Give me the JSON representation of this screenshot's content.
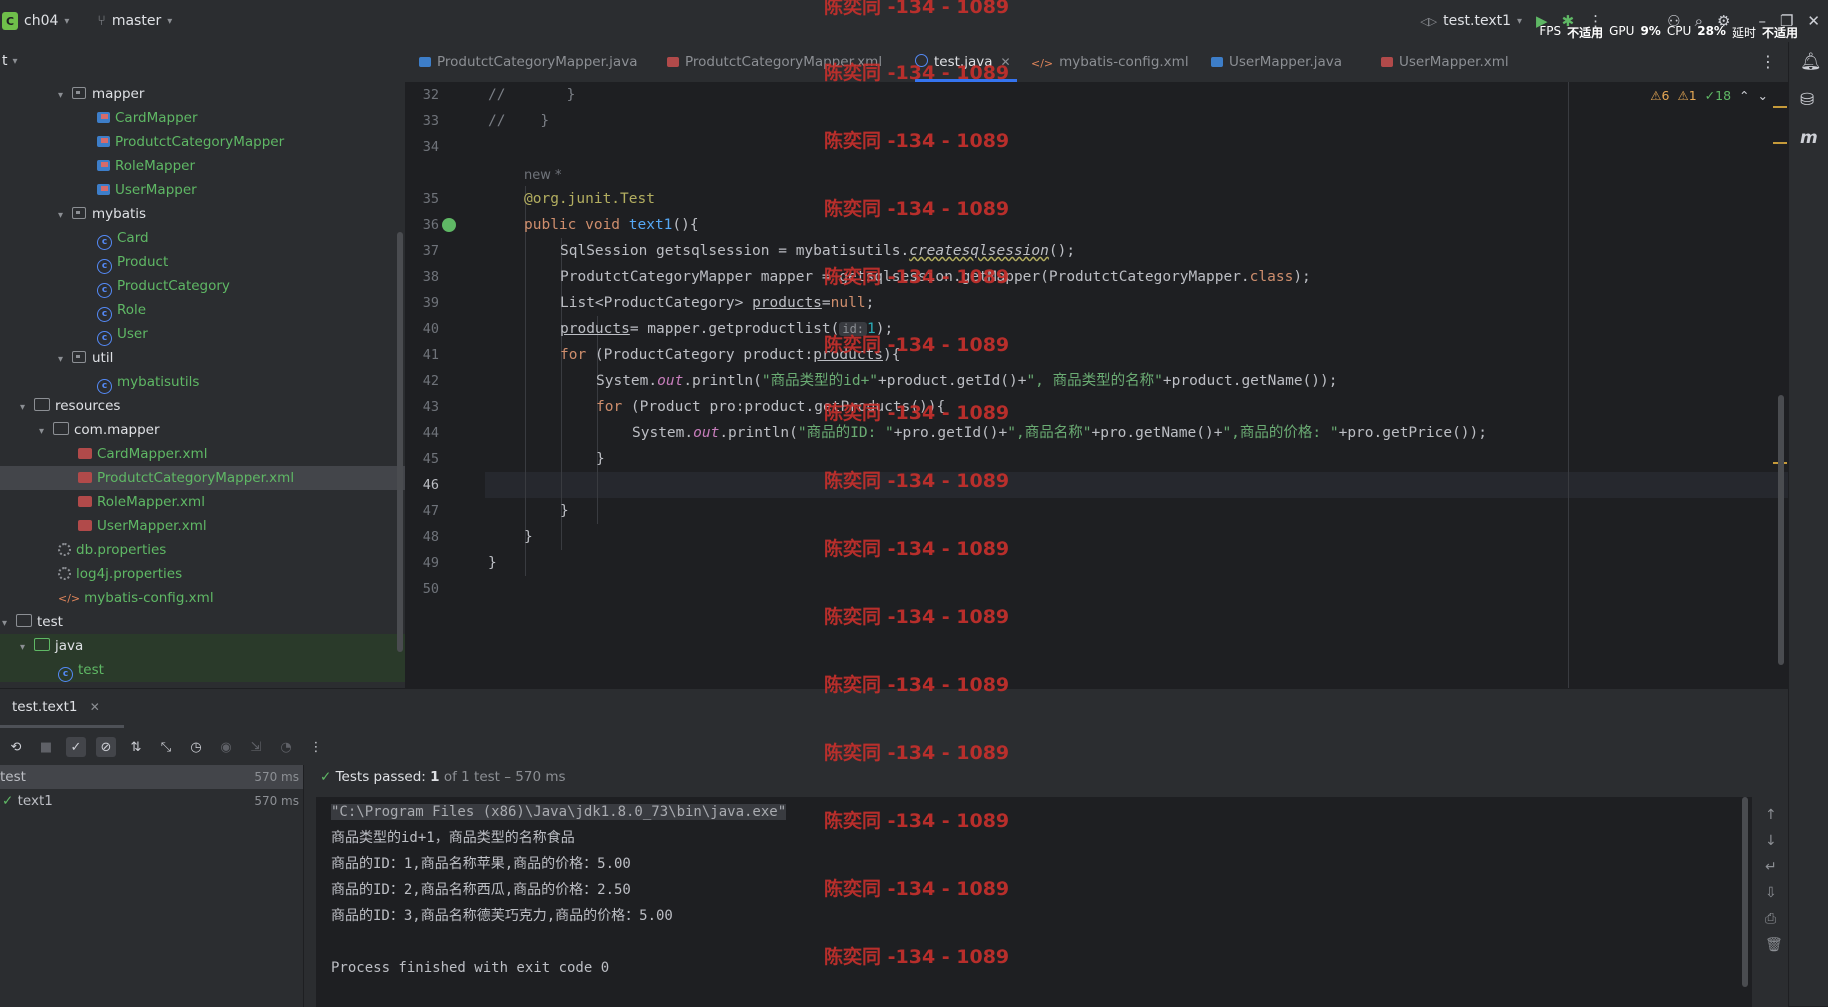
{
  "titlebar": {
    "project_badge": "C",
    "project": "ch04",
    "branch": "master",
    "run_config": "test.text1",
    "sysmon": {
      "fps_label": "FPS",
      "fps_value": "不适用",
      "gpu_label": "GPU",
      "gpu_value": "9%",
      "cpu_label": "CPU",
      "cpu_value": "28%",
      "latency_label": "延时",
      "latency_value": "不适用"
    }
  },
  "project_panel": {
    "header": "t",
    "rows": [
      {
        "label": "mapper"
      },
      {
        "label": "CardMapper"
      },
      {
        "label": "ProdutctCategoryMapper"
      },
      {
        "label": "RoleMapper"
      },
      {
        "label": "UserMapper"
      },
      {
        "label": "mybatis"
      },
      {
        "label": "Card"
      },
      {
        "label": "Product"
      },
      {
        "label": "ProductCategory"
      },
      {
        "label": "Role"
      },
      {
        "label": "User"
      },
      {
        "label": "util"
      },
      {
        "label": "mybatisutils"
      },
      {
        "label": "resources"
      },
      {
        "label": "com.mapper"
      },
      {
        "label": "CardMapper.xml"
      },
      {
        "label": "ProdutctCategoryMapper.xml"
      },
      {
        "label": "RoleMapper.xml"
      },
      {
        "label": "UserMapper.xml"
      },
      {
        "label": "db.properties"
      },
      {
        "label": "log4j.properties"
      },
      {
        "label": "mybatis-config.xml"
      },
      {
        "label": "test"
      },
      {
        "label": "java"
      },
      {
        "label": "test"
      }
    ]
  },
  "editor_tabs": [
    {
      "label": "ProdutctCategoryMapper.java"
    },
    {
      "label": "ProdutctCategoryMapper.xml"
    },
    {
      "label": "test.java"
    },
    {
      "label": "mybatis-config.xml"
    },
    {
      "label": "UserMapper.java"
    },
    {
      "label": "UserMapper.xml"
    }
  ],
  "inspections": {
    "warnings": "6",
    "weak_warnings": "1",
    "ok": "18"
  },
  "editor": {
    "line_numbers": [
      "32",
      "33",
      "34",
      "35",
      "36",
      "37",
      "38",
      "39",
      "40",
      "41",
      "42",
      "43",
      "44",
      "45",
      "46",
      "47",
      "48",
      "49",
      "50"
    ],
    "new_marker": "new *",
    "l32": "//       }",
    "l33": "//    }",
    "l35_ann": "@org.junit.Test",
    "l36_kw": "public void ",
    "l36_fn": "text1",
    "l36_rest": "(){",
    "l37_a": "SqlSession getsqlsession = mybatisutils.",
    "l37_b": "createsqlsession",
    "l37_c": "();",
    "l38_a": "ProdutctCategoryMapper mapper = getsqlsession.getMapper(ProdutctCategoryMapper.",
    "l38_kw": "class",
    "l38_c": ");",
    "l39_a": "List<ProductCategory> ",
    "l39_var": "products",
    "l39_b": "=",
    "l39_null": "null",
    "l39_c": ";",
    "l40_var": "products",
    "l40_a": "= mapper.getproductlist(",
    "l40_hint": "id:",
    "l40_num": "1",
    "l40_b": ");",
    "l41_kw": "for",
    "l41_a": " (ProductCategory product:",
    "l41_var": "products",
    "l41_b": "){",
    "l42_a": "System.",
    "l42_out": "out",
    "l42_b": ".println(",
    "l42_s1": "\"商品类型的id+\"",
    "l42_c": "+product.getId()+",
    "l42_s2": "\", 商品类型的名称\"",
    "l42_d": "+product.getName());",
    "l43_kw": "for",
    "l43_a": " (Product pro:product.getProducts()){",
    "l44_a": "System.",
    "l44_out": "out",
    "l44_b": ".println(",
    "l44_s1": "\"商品的ID: \"",
    "l44_c": "+pro.getId()+",
    "l44_s2": "\",商品名称\"",
    "l44_d": "+pro.getName()+",
    "l44_s3": "\",商品的价格: \"",
    "l44_e": "+pro.getPrice());",
    "l45": "}",
    "l47": "}",
    "l48": "}",
    "l49": "}"
  },
  "run_panel": {
    "tab": "test.text1",
    "tree": [
      {
        "label": "test",
        "time": "570 ms"
      },
      {
        "label": "text1",
        "time": "570 ms"
      }
    ],
    "status_prefix": "Tests passed: ",
    "status_count": "1",
    "status_suffix": " of 1 test – 570 ms",
    "console": [
      "\"C:\\Program Files (x86)\\Java\\jdk1.8.0_73\\bin\\java.exe\"",
      "商品类型的id+1，商品类型的名称食品",
      "商品的ID：1,商品名称苹果,商品的价格：5.00",
      "商品的ID：2,商品名称西瓜,商品的价格：2.50",
      "商品的ID：3,商品名称德芙巧克力,商品的价格：5.00",
      "",
      "Process finished with exit code 0"
    ]
  },
  "watermark": "陈奕同 -134 - 1089",
  "colors": {
    "accent": "#3574f0",
    "success": "#5fb865",
    "watermark": "#c9302c"
  }
}
